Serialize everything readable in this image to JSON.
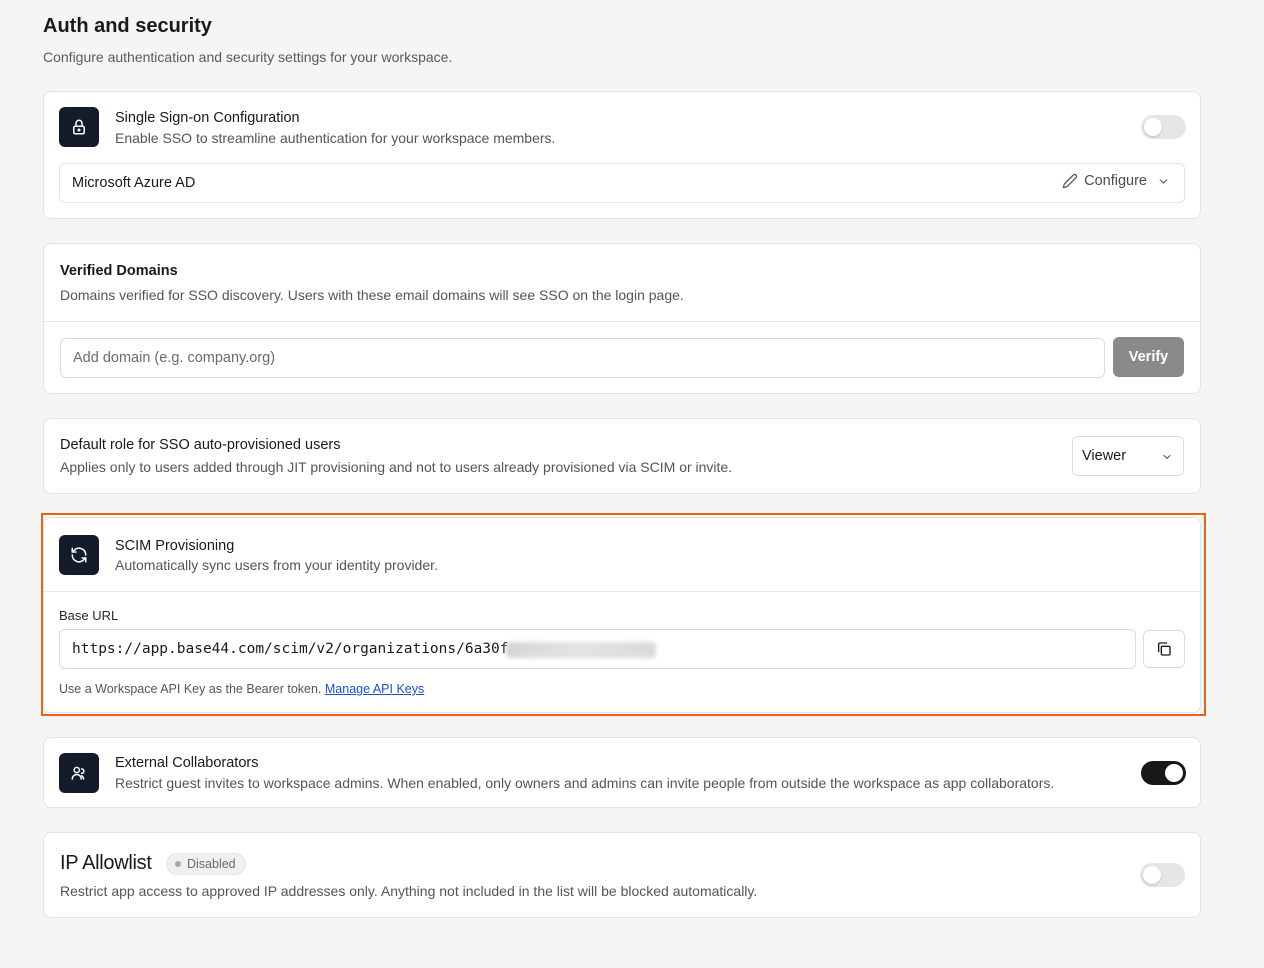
{
  "page": {
    "title": "Auth and security",
    "subtitle": "Configure authentication and security settings for your workspace."
  },
  "sso": {
    "icon": "lock-icon",
    "title": "Single Sign-on Configuration",
    "description": "Enable SSO to streamline authentication for your workspace members.",
    "enabled": false,
    "provider": "Microsoft Azure AD",
    "configure_label": "Configure"
  },
  "domains": {
    "title": "Verified Domains",
    "description": "Domains verified for SSO discovery. Users with these email domains will see SSO on the login page.",
    "input_placeholder": "Add domain (e.g. company.org)",
    "verify_label": "Verify"
  },
  "role": {
    "title": "Default role for SSO auto-provisioned users",
    "description": "Applies only to users added through JIT provisioning and not to users already provisioned via SCIM or invite.",
    "selected": "Viewer"
  },
  "scim": {
    "icon": "refresh-icon",
    "title": "SCIM Provisioning",
    "description": "Automatically sync users from your identity provider.",
    "base_url_label": "Base URL",
    "base_url": "https://app.base44.com/scim/v2/organizations/6a30fa",
    "hint": "Use a Workspace API Key as the Bearer token.",
    "hint_link": "Manage API Keys"
  },
  "collaborators": {
    "icon": "users-icon",
    "title": "External Collaborators",
    "description": "Restrict guest invites to workspace admins. When enabled, only owners and admins can invite people from outside the workspace as app collaborators.",
    "enabled": true
  },
  "ip_allowlist": {
    "title": "IP Allowlist",
    "badge": "Disabled",
    "description": "Restrict app access to approved IP addresses only. Anything not included in the list will be blocked automatically.",
    "enabled": false
  },
  "colors": {
    "accent_highlight": "#e8631c",
    "icon_bg": "#141b2b",
    "link": "#1d4fd8"
  }
}
